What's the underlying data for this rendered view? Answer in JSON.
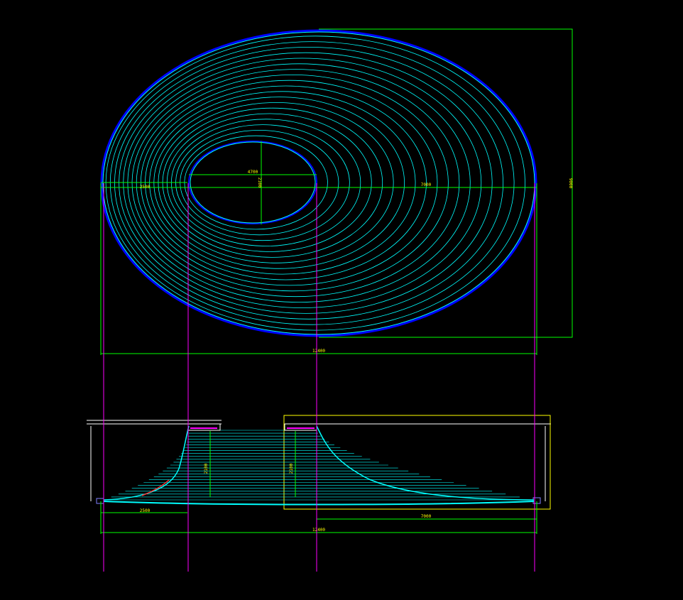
{
  "colors": {
    "background": "#000000",
    "contour": "#00ffff",
    "outline": "#0000ff",
    "dimension": "#00ff00",
    "text": "#ffff00",
    "guide": "#ff00ff",
    "section": "#ffffff",
    "highlight": "#ff3030"
  },
  "plan": {
    "dims": {
      "left_radius": "2500",
      "opening_width": "4700",
      "opening_depth": "2100",
      "right_radius": "7000",
      "overall_width": "12400",
      "overall_height": "9000"
    }
  },
  "section": {
    "dims": {
      "left_width": "2500",
      "height_left": "2100",
      "height_right": "2100",
      "right_width": "7000",
      "overall_width": "12400"
    }
  }
}
